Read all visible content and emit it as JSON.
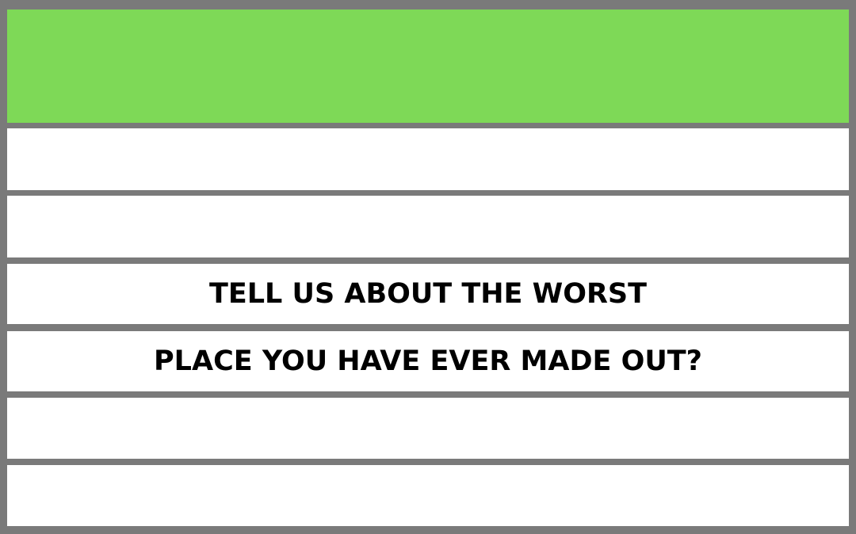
{
  "question": {
    "line1": "TELL US ABOUT THE WORST",
    "line2": "PLACE YOU HAVE EVER MADE OUT?"
  },
  "colors": {
    "frame": "#7a7a7a",
    "header": "#7ed957",
    "row": "#ffffff",
    "text": "#000000"
  }
}
